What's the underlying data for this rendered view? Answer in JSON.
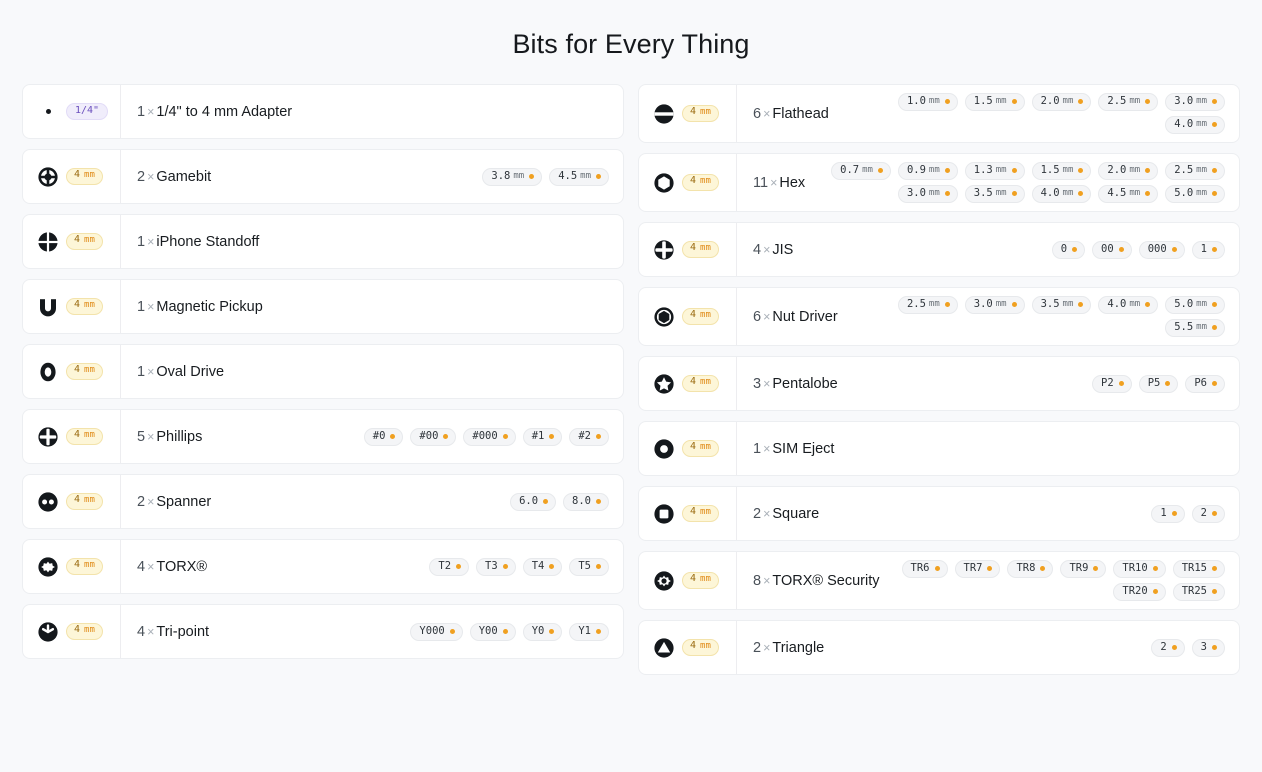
{
  "page": {
    "title": "Bits for Every Thing",
    "background_color": "#f8f9fb",
    "card_color": "#ffffff",
    "accent_dot_color": "#f0a020",
    "badge_amber_bg": "#fdf6d8",
    "badge_purple_bg": "#f0edfb"
  },
  "columns": [
    {
      "side": "left",
      "rows": [
        {
          "icon": "bullet-dot-icon",
          "badge": {
            "value": "1/4\"",
            "unit": "",
            "kind": "adapter"
          },
          "count": "1",
          "separator": "×",
          "name": "1/4\" to 4 mm Adapter",
          "chips": []
        },
        {
          "icon": "gamebit-icon",
          "badge": {
            "value": "4",
            "unit": "mm",
            "kind": "mm"
          },
          "count": "2",
          "separator": "×",
          "name": "Gamebit",
          "chips": [
            {
              "value": "3.8",
              "unit": "mm"
            },
            {
              "value": "4.5",
              "unit": "mm"
            }
          ]
        },
        {
          "icon": "iphone-standoff-icon",
          "badge": {
            "value": "4",
            "unit": "mm",
            "kind": "mm"
          },
          "count": "1",
          "separator": "×",
          "name": "iPhone Standoff",
          "chips": []
        },
        {
          "icon": "magnetic-pickup-icon",
          "badge": {
            "value": "4",
            "unit": "mm",
            "kind": "mm"
          },
          "count": "1",
          "separator": "×",
          "name": "Magnetic Pickup",
          "chips": []
        },
        {
          "icon": "oval-drive-icon",
          "badge": {
            "value": "4",
            "unit": "mm",
            "kind": "mm"
          },
          "count": "1",
          "separator": "×",
          "name": "Oval Drive",
          "chips": []
        },
        {
          "icon": "phillips-icon",
          "badge": {
            "value": "4",
            "unit": "mm",
            "kind": "mm"
          },
          "count": "5",
          "separator": "×",
          "name": "Phillips",
          "chips": [
            {
              "value": "#0",
              "unit": ""
            },
            {
              "value": "#00",
              "unit": ""
            },
            {
              "value": "#000",
              "unit": ""
            },
            {
              "value": "#1",
              "unit": ""
            },
            {
              "value": "#2",
              "unit": ""
            }
          ]
        },
        {
          "icon": "spanner-icon",
          "badge": {
            "value": "4",
            "unit": "mm",
            "kind": "mm"
          },
          "count": "2",
          "separator": "×",
          "name": "Spanner",
          "chips": [
            {
              "value": "6.0",
              "unit": ""
            },
            {
              "value": "8.0",
              "unit": ""
            }
          ]
        },
        {
          "icon": "torx-icon",
          "badge": {
            "value": "4",
            "unit": "mm",
            "kind": "mm"
          },
          "count": "4",
          "separator": "×",
          "name": "TORX®",
          "chips": [
            {
              "value": "T2",
              "unit": ""
            },
            {
              "value": "T3",
              "unit": ""
            },
            {
              "value": "T4",
              "unit": ""
            },
            {
              "value": "T5",
              "unit": ""
            }
          ]
        },
        {
          "icon": "tri-point-icon",
          "badge": {
            "value": "4",
            "unit": "mm",
            "kind": "mm"
          },
          "count": "4",
          "separator": "×",
          "name": "Tri-point",
          "chips": [
            {
              "value": "Y000",
              "unit": ""
            },
            {
              "value": "Y00",
              "unit": ""
            },
            {
              "value": "Y0",
              "unit": ""
            },
            {
              "value": "Y1",
              "unit": ""
            }
          ]
        }
      ]
    },
    {
      "side": "right",
      "rows": [
        {
          "icon": "flathead-icon",
          "badge": {
            "value": "4",
            "unit": "mm",
            "kind": "mm"
          },
          "count": "6",
          "separator": "×",
          "name": "Flathead",
          "chips": [
            {
              "value": "1.0",
              "unit": "mm"
            },
            {
              "value": "1.5",
              "unit": "mm"
            },
            {
              "value": "2.0",
              "unit": "mm"
            },
            {
              "value": "2.5",
              "unit": "mm"
            },
            {
              "value": "3.0",
              "unit": "mm"
            },
            {
              "value": "4.0",
              "unit": "mm"
            }
          ]
        },
        {
          "icon": "hex-icon",
          "badge": {
            "value": "4",
            "unit": "mm",
            "kind": "mm"
          },
          "count": "11",
          "separator": "×",
          "name": "Hex",
          "chips": [
            {
              "value": "0.7",
              "unit": "mm"
            },
            {
              "value": "0.9",
              "unit": "mm"
            },
            {
              "value": "1.3",
              "unit": "mm"
            },
            {
              "value": "1.5",
              "unit": "mm"
            },
            {
              "value": "2.0",
              "unit": "mm"
            },
            {
              "value": "2.5",
              "unit": "mm"
            },
            {
              "value": "3.0",
              "unit": "mm"
            },
            {
              "value": "3.5",
              "unit": "mm"
            },
            {
              "value": "4.0",
              "unit": "mm"
            },
            {
              "value": "4.5",
              "unit": "mm"
            },
            {
              "value": "5.0",
              "unit": "mm"
            }
          ]
        },
        {
          "icon": "jis-icon",
          "badge": {
            "value": "4",
            "unit": "mm",
            "kind": "mm"
          },
          "count": "4",
          "separator": "×",
          "name": "JIS",
          "chips": [
            {
              "value": "0",
              "unit": ""
            },
            {
              "value": "00",
              "unit": ""
            },
            {
              "value": "000",
              "unit": ""
            },
            {
              "value": "1",
              "unit": ""
            }
          ]
        },
        {
          "icon": "nut-driver-icon",
          "badge": {
            "value": "4",
            "unit": "mm",
            "kind": "mm"
          },
          "count": "6",
          "separator": "×",
          "name": "Nut Driver",
          "chips": [
            {
              "value": "2.5",
              "unit": "mm"
            },
            {
              "value": "3.0",
              "unit": "mm"
            },
            {
              "value": "3.5",
              "unit": "mm"
            },
            {
              "value": "4.0",
              "unit": "mm"
            },
            {
              "value": "5.0",
              "unit": "mm"
            },
            {
              "value": "5.5",
              "unit": "mm"
            }
          ]
        },
        {
          "icon": "pentalobe-icon",
          "badge": {
            "value": "4",
            "unit": "mm",
            "kind": "mm"
          },
          "count": "3",
          "separator": "×",
          "name": "Pentalobe",
          "chips": [
            {
              "value": "P2",
              "unit": ""
            },
            {
              "value": "P5",
              "unit": ""
            },
            {
              "value": "P6",
              "unit": ""
            }
          ]
        },
        {
          "icon": "sim-eject-icon",
          "badge": {
            "value": "4",
            "unit": "mm",
            "kind": "mm"
          },
          "count": "1",
          "separator": "×",
          "name": "SIM Eject",
          "chips": []
        },
        {
          "icon": "square-icon",
          "badge": {
            "value": "4",
            "unit": "mm",
            "kind": "mm"
          },
          "count": "2",
          "separator": "×",
          "name": "Square",
          "chips": [
            {
              "value": "1",
              "unit": ""
            },
            {
              "value": "2",
              "unit": ""
            }
          ]
        },
        {
          "icon": "torx-security-icon",
          "badge": {
            "value": "4",
            "unit": "mm",
            "kind": "mm"
          },
          "count": "8",
          "separator": "×",
          "name": "TORX® Security",
          "chips": [
            {
              "value": "TR6",
              "unit": ""
            },
            {
              "value": "TR7",
              "unit": ""
            },
            {
              "value": "TR8",
              "unit": ""
            },
            {
              "value": "TR9",
              "unit": ""
            },
            {
              "value": "TR10",
              "unit": ""
            },
            {
              "value": "TR15",
              "unit": ""
            },
            {
              "value": "TR20",
              "unit": ""
            },
            {
              "value": "TR25",
              "unit": ""
            }
          ]
        },
        {
          "icon": "triangle-icon",
          "badge": {
            "value": "4",
            "unit": "mm",
            "kind": "mm"
          },
          "count": "2",
          "separator": "×",
          "name": "Triangle",
          "chips": [
            {
              "value": "2",
              "unit": ""
            },
            {
              "value": "3",
              "unit": ""
            }
          ]
        }
      ]
    }
  ]
}
